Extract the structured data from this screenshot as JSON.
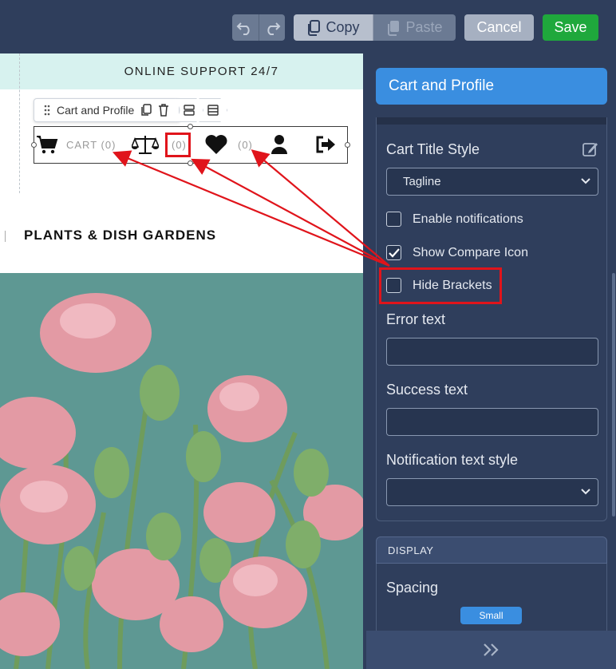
{
  "toolbar": {
    "copy_label": "Copy",
    "paste_label": "Paste",
    "cancel_label": "Cancel",
    "save_label": "Save"
  },
  "canvas": {
    "support_text": "ONLINE SUPPORT 24/7",
    "crumb_label": "Cart and Profile",
    "cart_label": "CART (0)",
    "compare_count": "(0)",
    "wishlist_count": "(0)",
    "section_title": "PLANTS & DISH GARDENS"
  },
  "panel": {
    "title": "Cart and Profile",
    "cart_title_style_label": "Cart Title Style",
    "cart_title_style_value": "Tagline",
    "enable_notifications_label": "Enable notifications",
    "enable_notifications_checked": false,
    "show_compare_label": "Show Compare Icon",
    "show_compare_checked": true,
    "hide_brackets_label": "Hide Brackets",
    "hide_brackets_checked": false,
    "error_text_label": "Error text",
    "error_text_value": "",
    "success_text_label": "Success text",
    "success_text_value": "",
    "notification_style_label": "Notification text style",
    "notification_style_value": "",
    "display_header": "DISPLAY",
    "spacing_label": "Spacing",
    "spacing_value": "Small"
  },
  "colors": {
    "accent": "#3a8ee0",
    "save": "#1fa83c",
    "highlight": "#e0141b",
    "panel_bg": "#2f3e5c"
  }
}
